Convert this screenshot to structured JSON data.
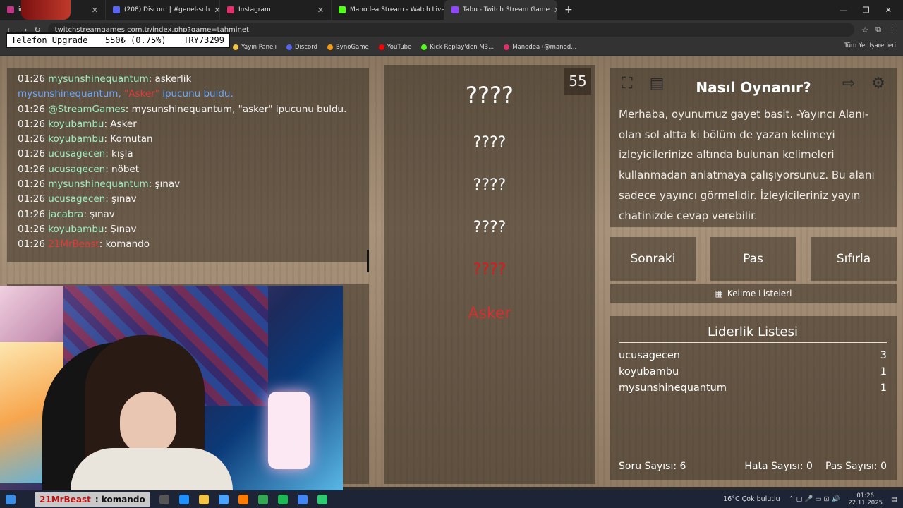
{
  "tabs": [
    {
      "label": "instagr",
      "color": "#c13584"
    },
    {
      "label": "(208) Discord | #genel-soh",
      "color": "#5865f2"
    },
    {
      "label": "Instagram",
      "color": "#e1306c"
    },
    {
      "label": "Manodea Stream - Watch Live",
      "color": "#53fc18"
    },
    {
      "label": "Tabu - Twitch Stream Game",
      "color": "#9146ff"
    }
  ],
  "url": "twitchstreamgames.com.tr/index.php?game=tahminet",
  "overlay": {
    "label": "Telefon Upgrade",
    "amount": "550₺ (0.75%)",
    "code": "TRY73299"
  },
  "bookmarks": [
    "Yayın Paneli",
    "Discord",
    "BynoGame",
    "YouTube",
    "Kick Replay'den M3...",
    "Manodea (@manod..."
  ],
  "all_bookmarks": "Tüm Yer İşaretleri",
  "chat": [
    {
      "time": "01:26",
      "user": "mysunshinequantum",
      "msg": ": askerlik",
      "type": "green"
    },
    {
      "time": "",
      "user": "mysunshinequantum, ",
      "hint": "\"Asker\"",
      "msg": " ipucunu buldu.",
      "type": "sys"
    },
    {
      "time": "01:26",
      "user": "@StreamGames",
      "msg": ": mysunshinequantum, \"asker\" ipucunu buldu.",
      "type": "green"
    },
    {
      "time": "01:26",
      "user": "koyubambu",
      "msg": ": Asker",
      "type": "green"
    },
    {
      "time": "01:26",
      "user": "koyubambu",
      "msg": ": Komutan",
      "type": "green"
    },
    {
      "time": "01:26",
      "user": "ucusagecen",
      "msg": ": kışla",
      "type": "green"
    },
    {
      "time": "01:26",
      "user": "ucusagecen",
      "msg": ": nöbet",
      "type": "green"
    },
    {
      "time": "01:26",
      "user": "mysunshinequantum",
      "msg": ": şınav",
      "type": "green"
    },
    {
      "time": "01:26",
      "user": "ucusagecen",
      "msg": ": şınav",
      "type": "green"
    },
    {
      "time": "01:26",
      "user": "jacabra",
      "msg": ": şınav",
      "type": "green"
    },
    {
      "time": "01:26",
      "user": "koyubambu",
      "msg": ": Şınav",
      "type": "green"
    },
    {
      "time": "01:26",
      "user": "21MrBeast",
      "msg": ": komando",
      "type": "red"
    }
  ],
  "timer": "55",
  "words": [
    "????",
    "????",
    "????",
    "????",
    "????",
    "Asker"
  ],
  "how": {
    "title": "Nasıl Oynanır?",
    "text": "Merhaba, oyunumuz gayet basit. -Yayıncı Alanı- olan sol altta ki bölüm de yazan kelimeyi izleyicilerinize altında bulunan kelimeleri kullanmadan anlatmaya çalışıyorsunuz. Bu alanı sadece yayıncı görmelidir. İzleyicileriniz yayın chatinizde cevap verebilir."
  },
  "buttons": {
    "next": "Sonraki",
    "pass": "Pas",
    "reset": "Sıfırla",
    "lists": "Kelime Listeleri"
  },
  "leaderboard": {
    "title": "Liderlik Listesi",
    "rows": [
      {
        "name": "ucusagecen",
        "score": "3"
      },
      {
        "name": "koyubambu",
        "score": "1"
      },
      {
        "name": "mysunshinequantum",
        "score": "1"
      }
    ],
    "questions": "Soru Sayısı: 6",
    "errors": "Hata Sayısı: 0",
    "passes": "Pas Sayısı: 0"
  },
  "taskbar": {
    "alert_name": "21MrBeast",
    "alert_msg": ": komando",
    "weather": "16°C  Çok bulutlu",
    "time": "01:26",
    "date": "22.11.2025"
  }
}
